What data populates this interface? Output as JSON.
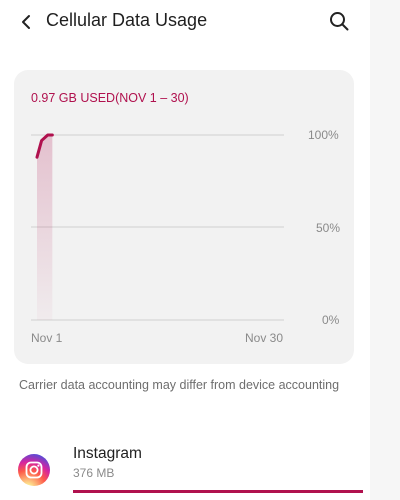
{
  "header": {
    "title": "Cellular Data Usage",
    "back_icon": "back-arrow-icon",
    "search_icon": "search-icon"
  },
  "usage_card": {
    "summary": "0.97 GB USED(NOV 1 – 30)",
    "accent_color": "#b0114e"
  },
  "chart_data": {
    "type": "line",
    "x": [
      "Nov 1",
      "Nov 30"
    ],
    "y_ticks": [
      "100%",
      "50%",
      "0%"
    ],
    "ylim": [
      0,
      100
    ],
    "series": [
      {
        "x": [
          1,
          1.6,
          2.4,
          3
        ],
        "values": [
          88,
          97,
          100,
          100
        ]
      }
    ],
    "grid": true
  },
  "footnote": "Carrier data accounting may differ from device accounting",
  "apps": [
    {
      "name": "Instagram",
      "usage": "376 MB",
      "usage_fraction": 1.0,
      "icon": "instagram-icon"
    }
  ]
}
